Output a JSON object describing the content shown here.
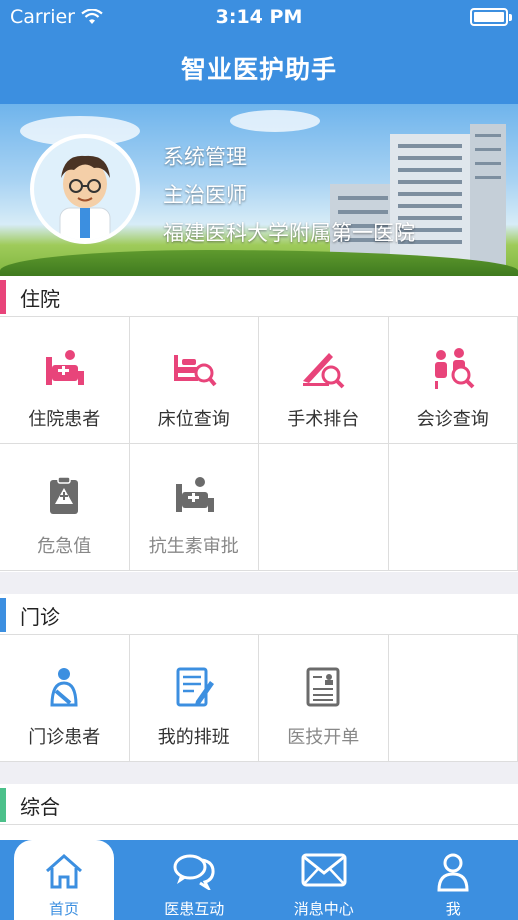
{
  "status_bar": {
    "carrier": "Carrier",
    "time": "3:14 PM"
  },
  "nav": {
    "title": "智业医护助手"
  },
  "profile": {
    "role": "系统管理",
    "title": "主治医师",
    "hospital": "福建医科大学附属第一医院"
  },
  "sections": {
    "inpatient": {
      "title": "住院",
      "accent": "#e8447a",
      "items": [
        {
          "label": "住院患者",
          "icon": "inpatient-bed-icon"
        },
        {
          "label": "床位查询",
          "icon": "bed-search-icon"
        },
        {
          "label": "手术排台",
          "icon": "surgery-icon"
        },
        {
          "label": "会诊查询",
          "icon": "consultation-icon"
        },
        {
          "label": "危急值",
          "icon": "critical-value-icon"
        },
        {
          "label": "抗生素审批",
          "icon": "antibiotic-approval-icon"
        }
      ]
    },
    "outpatient": {
      "title": "门诊",
      "accent": "#3c8fe0",
      "items": [
        {
          "label": "门诊患者",
          "icon": "outpatient-icon"
        },
        {
          "label": "我的排班",
          "icon": "schedule-icon"
        },
        {
          "label": "医技开单",
          "icon": "order-document-icon"
        }
      ]
    },
    "general": {
      "title": "综合",
      "accent": "#4cc08a"
    }
  },
  "tabbar": {
    "items": [
      {
        "label": "首页",
        "icon": "home-icon"
      },
      {
        "label": "医患互动",
        "icon": "chat-icon"
      },
      {
        "label": "消息中心",
        "icon": "mail-icon"
      },
      {
        "label": "我",
        "icon": "user-icon"
      }
    ]
  },
  "colors": {
    "primary": "#3c8fe0",
    "pink": "#e8447a",
    "gray_icon": "#6b6b6b",
    "green": "#4cc08a"
  }
}
